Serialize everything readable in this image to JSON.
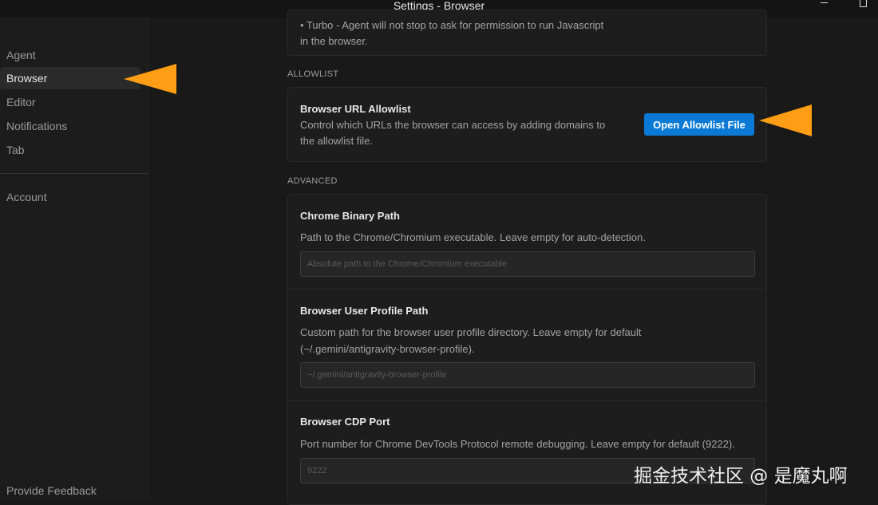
{
  "window": {
    "title": "Settings - Browser"
  },
  "sidebar": {
    "items": [
      {
        "label": "Agent"
      },
      {
        "label": "Browser"
      },
      {
        "label": "Editor"
      },
      {
        "label": "Notifications"
      },
      {
        "label": "Tab"
      }
    ],
    "account_label": "Account",
    "feedback_label": "Provide Feedback"
  },
  "top_card": {
    "line1": "• Turbo - Agent will not stop to ask for permission to run Javascript",
    "line2": "in the browser."
  },
  "allowlist": {
    "section_label": "ALLOWLIST",
    "title": "Browser URL Allowlist",
    "desc_line1": "Control which URLs the browser can access by adding domains to",
    "desc_line2": "the allowlist file.",
    "button_label": "Open Allowlist File"
  },
  "advanced": {
    "section_label": "ADVANCED",
    "chrome_binary": {
      "title": "Chrome Binary Path",
      "desc": "Path to the Chrome/Chromium executable. Leave empty for auto-detection.",
      "placeholder": "Absolute path to the Chrome/Chromium executable"
    },
    "profile_path": {
      "title": "Browser User Profile Path",
      "desc_line1": "Custom path for the browser user profile directory. Leave empty for default",
      "desc_line2": "(~/.gemini/antigravity-browser-profile).",
      "placeholder": "~/.gemini/antigravity-browser-profile"
    },
    "cdp_port": {
      "title": "Browser CDP Port",
      "desc": "Port number for Chrome DevTools Protocol remote debugging. Leave empty for default (9222).",
      "placeholder": "9222"
    }
  },
  "watermark": "掘金技术社区 @ 是魔丸啊",
  "colors": {
    "accent": "#0a7ad6",
    "annotation_arrow": "#ff9d14"
  }
}
